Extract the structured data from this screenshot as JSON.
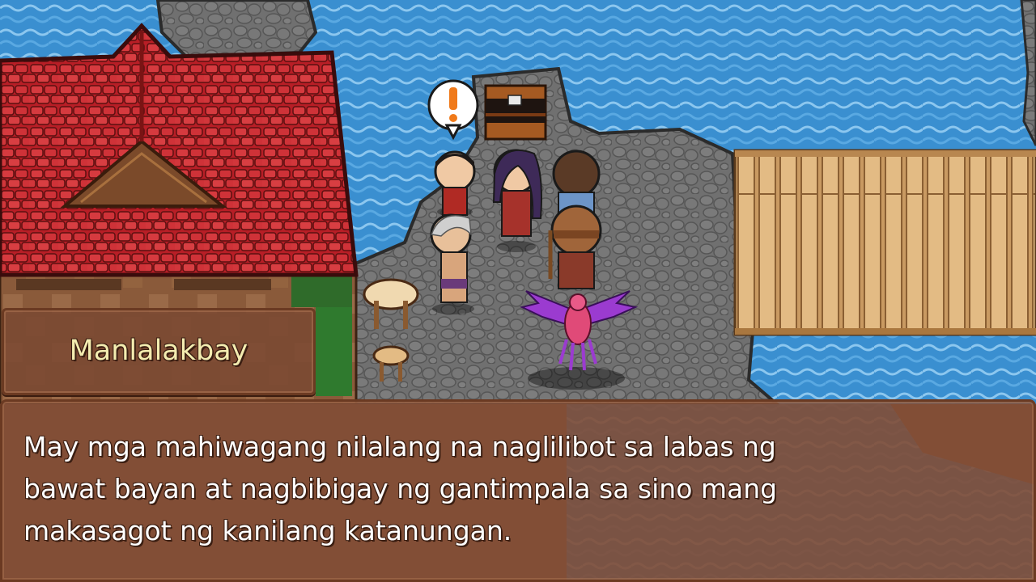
{
  "dialog": {
    "speaker": "Manlalakbay",
    "lines": [
      "May mga mahiwagang nilalang na naglilibot sa labas ng",
      "bawat bayan at nagbibigay ng gantimpala sa sino mang",
      "makasagot ng kanilang katanungan."
    ]
  },
  "scene": {
    "alert_icon": "exclamation-speech-bubble-icon",
    "colors": {
      "water": "#3a8fd0",
      "rock": "#6e6e6e",
      "roof": "#c8232b",
      "dock": "#d9b07a",
      "dialog_bg": "#804c36",
      "speaker_text": "#f3ecb0"
    }
  }
}
